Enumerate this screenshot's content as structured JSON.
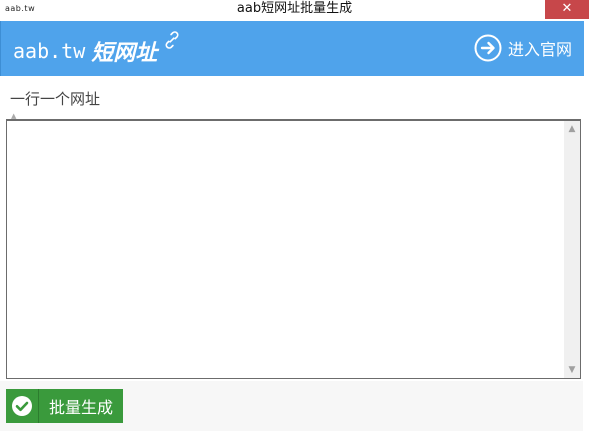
{
  "window": {
    "title": "aab短网址批量生成",
    "app_icon_text": "aab.tw",
    "close_label": "✕"
  },
  "header": {
    "brand_domain": "aab.tw",
    "brand_name": "短网址",
    "enter_site_label": "进入官网",
    "background_color": "#4fa3eb"
  },
  "input": {
    "hint": "一行一个网址",
    "value": ""
  },
  "footer": {
    "generate_label": "批量生成",
    "button_color": "#3a9a3c"
  }
}
